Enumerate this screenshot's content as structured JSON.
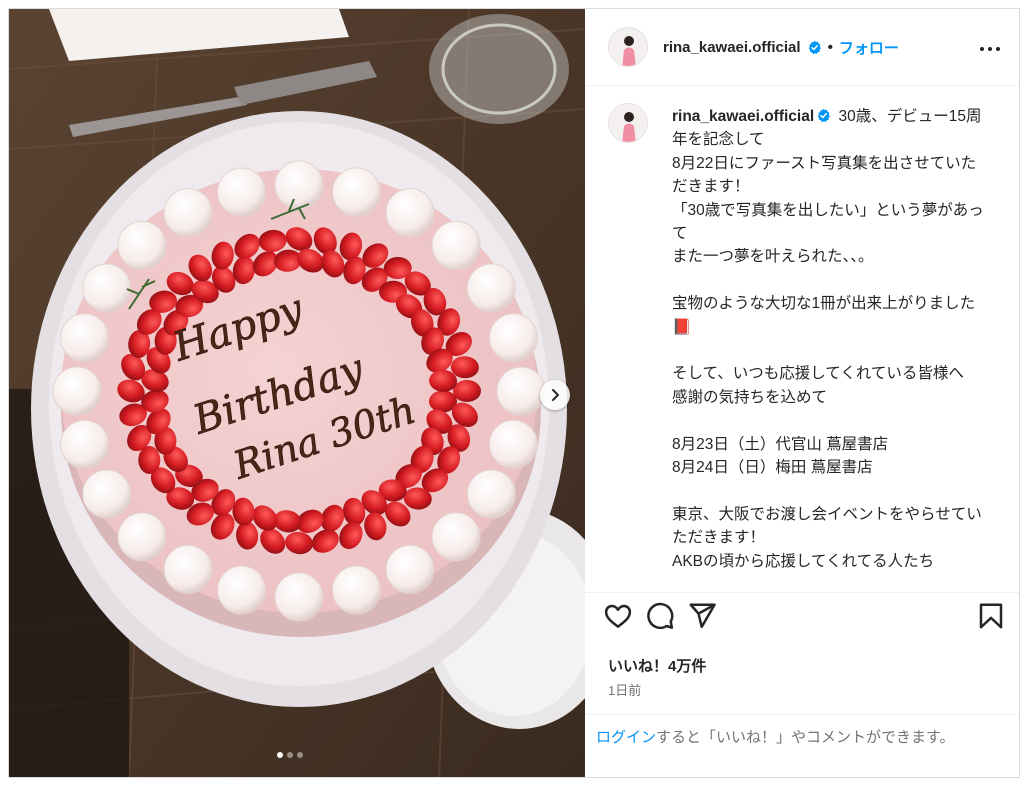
{
  "post": {
    "username": "rina_kawaei.official",
    "dot": "•",
    "follow_label": "フォロー",
    "caption_text": " 30歳、デビュー15周年を記念して\n8月22日にファースト写真集を出させていただきます！\n「30歳で写真集を出したい」という夢があって\nまた一つ夢を叶えられた、、。\n\n宝物のような大切な1冊が出来上がりました 📕\n\nそして、いつも応援してくれている皆様へ\n感謝の気持ちを込めて\n\n8月23日（土）代官山 蔦屋書店\n8月24日（日）梅田 蔦屋書店\n\n東京、大阪でお渡し会イベントをやらせていただきます！\nAKBの頃から応援してくれてる人たち",
    "likes": "いいね！4万件",
    "time": "1日前"
  },
  "photo": {
    "cake_text": [
      "Happy",
      "Birthday",
      "Rina 30th"
    ],
    "carousel": {
      "count": 3,
      "active_index": 0
    }
  },
  "login_bar": {
    "link": "ログイン",
    "rest": "すると「いいね！」やコメントができます。"
  },
  "icons": {
    "verified": "verified-badge-icon",
    "more": "more-options-icon",
    "like": "heart-icon",
    "comment": "comment-icon",
    "share": "share-icon",
    "save": "bookmark-icon",
    "next": "chevron-right-icon"
  },
  "colors": {
    "accent": "#0095f6",
    "verified": "#0095f6"
  }
}
